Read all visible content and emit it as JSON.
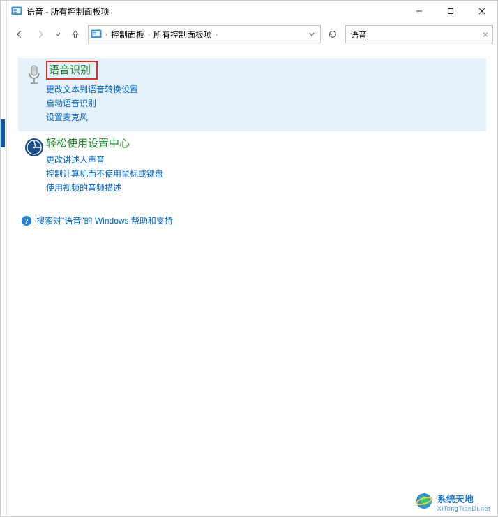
{
  "titlebar": {
    "title": "语音 - 所有控制面板项"
  },
  "breadcrumbs": {
    "item0": "控制面板",
    "item1": "所有控制面板项"
  },
  "search": {
    "value": "语音"
  },
  "results": [
    {
      "title": "语音识别",
      "links": [
        "更改文本到语音转换设置",
        "启动语音识别",
        "设置麦克风"
      ]
    },
    {
      "title": "轻松使用设置中心",
      "links": [
        "更改讲述人声音",
        "控制计算机而不使用鼠标或键盘",
        "使用视频的音频描述"
      ]
    }
  ],
  "help": {
    "text": "搜索对\"语音\"的 Windows 帮助和支持"
  },
  "watermark": {
    "title": "系统天地",
    "url": "XiTongTianDi.net"
  }
}
